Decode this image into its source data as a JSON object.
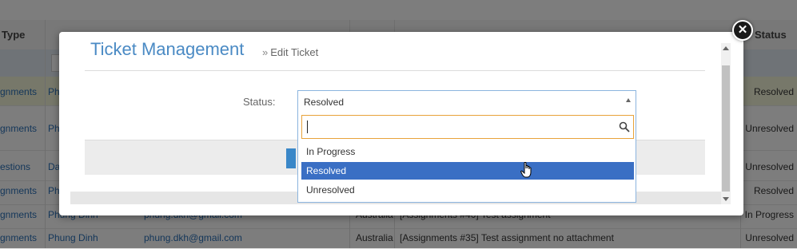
{
  "background": {
    "headers": {
      "type": "Type",
      "status": "Status"
    },
    "rows": [
      {
        "type": "gnments",
        "name": "Ph",
        "email": "",
        "country": "",
        "subject": "",
        "status": "Resolved"
      },
      {
        "type": "gnments",
        "name": "Ph",
        "email": "",
        "country": "",
        "subject": "",
        "status": "Unresolved"
      },
      {
        "type": "estions",
        "name": "Da",
        "email": "",
        "country": "",
        "subject": "",
        "status": "Unresolved"
      },
      {
        "type": "gnments",
        "name": "Ph",
        "email": "",
        "country": "",
        "subject": "",
        "status": "Resolved"
      },
      {
        "type": "gnments",
        "name": "Phung Dinh",
        "email": "phung.dkh@gmail.com",
        "country": "Australia",
        "subject": "[Assignments #40] Test assignment",
        "status": "In Progress"
      },
      {
        "type": "gnments",
        "name": "Phung Dinh",
        "email": "phung.dkh@gmail.com",
        "country": "Australia",
        "subject": "[Assignments #35] Test assignment no attachment",
        "status": "Unresolved"
      }
    ]
  },
  "modal": {
    "title": "Ticket Management",
    "breadcrumb_sep": "»",
    "breadcrumb": "Edit Ticket",
    "status_label": "Status:",
    "status_value": "Resolved",
    "search_value": "",
    "options": [
      "In Progress",
      "Resolved",
      "Unresolved"
    ],
    "selected_option": "Resolved"
  },
  "icons": {
    "close": "close-icon",
    "search": "search-icon",
    "cursor": "hand-pointer-icon"
  },
  "colors": {
    "accent": "#4a8ac4",
    "selection": "#3a6fc4",
    "search_border": "#e8a33a"
  }
}
